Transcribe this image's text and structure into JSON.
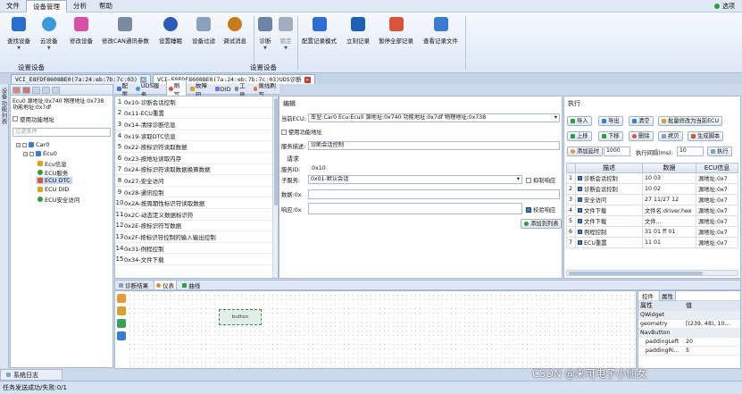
{
  "menu": {
    "items": [
      "文件",
      "设备管理",
      "分析",
      "帮助"
    ],
    "active": 1,
    "right": "选项"
  },
  "ribbon": {
    "buttons": [
      {
        "label": "查找设备",
        "caret": true,
        "color": "#2a6fd0"
      },
      {
        "label": "云设备",
        "caret": true,
        "color": "#3a9ad9"
      },
      {
        "label": "修改设备",
        "caret": false,
        "color": "#d94fa3"
      },
      {
        "label": "修改CAN通讯参数",
        "caret": false,
        "color": "#7a8aa0"
      },
      {
        "label": "设置睡眠",
        "caret": false,
        "color": "#2a5bb8"
      },
      {
        "label": "设备过滤",
        "caret": false,
        "color": "#8aa0bd"
      },
      {
        "label": "调试消息",
        "caret": false,
        "color": "#c87b1a"
      },
      {
        "label": "诊断",
        "caret": true,
        "color": "#6b84a8"
      },
      {
        "label": "锁定",
        "caret": true,
        "color": "#a0aec0"
      },
      {
        "label": "配置记录模式",
        "caret": false,
        "color": "#2c6ed5"
      },
      {
        "label": "立刻记录",
        "caret": false,
        "color": "#1e5fb6"
      },
      {
        "label": "暂停全部记录",
        "caret": false,
        "color": "#d9533a"
      },
      {
        "label": "查看记录文件",
        "caret": false,
        "color": "#3b7bd3"
      }
    ],
    "groups": [
      "设置设备",
      "设置设备"
    ]
  },
  "doc_tabs": [
    {
      "label": "VCI_E8FDF8608BE0(7a:24:eb:7b:7c:03)",
      "active": false
    },
    {
      "label": "VCI_E8FDF8608BE0(7a:24:eb:7b:7c:03)UDS诊断",
      "active": true
    }
  ],
  "vstrip": [
    "设备",
    "功能",
    "列表"
  ],
  "left": {
    "info_line1": "Ecu0 源地址:0x740 物理地址:0x738",
    "info_line2": "功能地址:0x7df",
    "use_func_addr": "使用功能地址",
    "filter_placeholder": "过滤条件",
    "tree": [
      {
        "label": "Car0",
        "level": 0,
        "color": "#3a7bd5"
      },
      {
        "label": "Ecu0",
        "level": 1,
        "color": "#3a7bd5"
      },
      {
        "label": "Ecu信息",
        "level": 2,
        "color": "#e0a020"
      },
      {
        "label": "ECU服务",
        "level": 2,
        "color": "#2e9e3e"
      },
      {
        "label": "ECU DTC",
        "level": 2,
        "color": "#d9533a",
        "selected": true
      },
      {
        "label": "ECU DID",
        "level": 2,
        "color": "#e0a020"
      },
      {
        "label": "ECU安全访问",
        "level": 2,
        "color": "#2e9e3e"
      }
    ]
  },
  "mid_tabs": [
    "配置",
    "UDS服务",
    "刷写",
    "故障码",
    "DID",
    "工具",
    "离线刷写"
  ],
  "services": [
    {
      "n": "1",
      "label": "0x10-诊断会话控制"
    },
    {
      "n": "2",
      "label": "0x11-ECU重置"
    },
    {
      "n": "3",
      "label": "0x14-清除诊断信息"
    },
    {
      "n": "4",
      "label": "0x19-读取DTC信息"
    },
    {
      "n": "5",
      "label": "0x22-按标识符读取数据"
    },
    {
      "n": "6",
      "label": "0x23-按地址读取内存"
    },
    {
      "n": "7",
      "label": "0x24-按标识符读取数据换算数据"
    },
    {
      "n": "8",
      "label": "0x27-安全访问"
    },
    {
      "n": "9",
      "label": "0x28-通讯控制"
    },
    {
      "n": "10",
      "label": "0x2A-按周期性标识符读取数据"
    },
    {
      "n": "11",
      "label": "0x2C-动态定义数据标识符"
    },
    {
      "n": "12",
      "label": "0x2E-按标识符写数据"
    },
    {
      "n": "13",
      "label": "0x2F-按标识符控制的输入输出控制"
    },
    {
      "n": "14",
      "label": "0x31-例程控制"
    },
    {
      "n": "15",
      "label": "0x34-文件下载"
    }
  ],
  "edit": {
    "title": "编辑",
    "current_ecu_label": "当前ECU:",
    "current_ecu_value": "车型:Car0 Ecu:Ecu0 源地址:0x740 功能地址:0x7df 物理地址:0x738",
    "use_func_addr": "使用功能地址",
    "service_desc_label": "服务描述:",
    "service_desc_value": "诊断会话控制",
    "request_title": "请求",
    "service_id_label": "服务ID:",
    "service_id_value": "0x10",
    "sub_service_label": "子服务:",
    "sub_service_value": "0x01-默认会话",
    "suppress_label": "抑制响应",
    "data_label": "数据:0x",
    "response_label": "响应:0x",
    "verify_label": "校验响应",
    "add_button": "添加到列表"
  },
  "exec": {
    "title": "执行",
    "buttons_row1": [
      "导入",
      "导出",
      "清空",
      "批量修改为当前ECU"
    ],
    "buttons_row2": [
      "上移",
      "下移",
      "删除",
      "拷贝",
      "生成脚本"
    ],
    "delay_label": "添加延时",
    "delay_value": "1000",
    "interval_label": "执行间隔(ms):",
    "interval_value": "10",
    "run_button": "执行",
    "columns": [
      "描述",
      "数据",
      "ECU信息"
    ],
    "rows": [
      {
        "n": "1",
        "desc": "诊断会话控制",
        "data": "10 03",
        "ecu": "源地址:0x7"
      },
      {
        "n": "2",
        "desc": "诊断会话控制",
        "data": "10 02",
        "ecu": "源地址:0x7"
      },
      {
        "n": "3",
        "desc": "安全访问",
        "data": "27 11/27 12",
        "ecu": "源地址:0x7"
      },
      {
        "n": "4",
        "desc": "文件下载",
        "data": "文件名:driver.hex",
        "ecu": "源地址:0x7"
      },
      {
        "n": "5",
        "desc": "文件下载",
        "data": "文件...",
        "ecu": "源地址:0x7"
      },
      {
        "n": "6",
        "desc": "例程控制",
        "data": "31 01 ff 01",
        "ecu": "源地址:0x7"
      },
      {
        "n": "7",
        "desc": "ECU重置",
        "data": "11 01",
        "ecu": "源地址:0x7"
      }
    ]
  },
  "bottom_tabs": [
    "诊断结果",
    "仪表",
    "曲线"
  ],
  "canvas_widget_label": "button",
  "prop": {
    "tabs": [
      "控件",
      "属性"
    ],
    "columns": [
      "属性",
      "值"
    ],
    "rows": [
      {
        "k": "QWidget",
        "v": "",
        "cat": true
      },
      {
        "k": "geometry",
        "v": "[(239, 48), 10...",
        "cat": false
      },
      {
        "k": "NavButton",
        "v": "",
        "cat": true
      },
      {
        "k": "paddingLeft",
        "v": "20",
        "cat": false
      },
      {
        "k": "paddingRi...",
        "v": "5",
        "cat": false
      }
    ]
  },
  "log_tab": "系统日志",
  "status": "任务发送成功/失败:0/1",
  "watermark": "CSDN @来可电子小仙女"
}
